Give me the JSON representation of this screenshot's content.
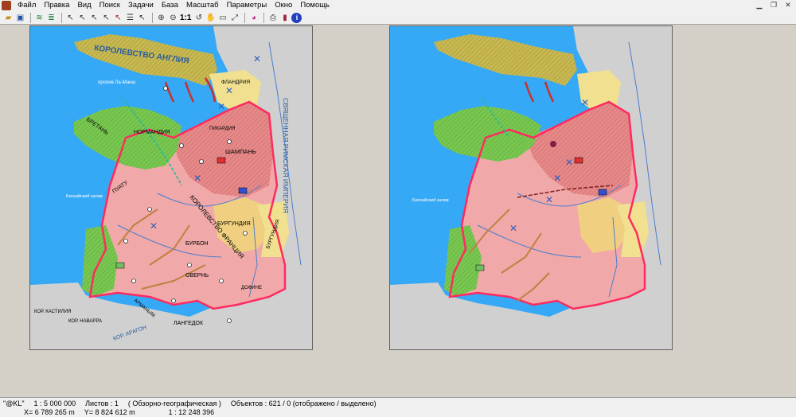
{
  "menu": [
    "Файл",
    "Правка",
    "Вид",
    "Поиск",
    "Задачи",
    "База",
    "Масштаб",
    "Параметры",
    "Окно",
    "Помощь"
  ],
  "toolbar": {
    "zoom_label": "1:1"
  },
  "icons": [
    "open-icon",
    "save-icon",
    "layers-icon",
    "select-icon",
    "zoom-in-icon",
    "zoom-out-icon",
    "hand-icon",
    "print-icon",
    "book-icon",
    "info-icon"
  ],
  "colors": {
    "sea": "#35a9f5",
    "land_gray": "#d0d0d0",
    "france": "#f0a8a8",
    "england": "#c8b850",
    "normandy": "#78c850",
    "burgundy": "#f0e090",
    "border": "#ff2a60"
  },
  "map_left": {
    "labels": {
      "england": "КОРОЛЕВСТВО АНГЛИЯ",
      "channel": "пролив Ла-Манш",
      "flanders": "ФЛАНДРИЯ",
      "normandy": "НОРМАНДИЯ",
      "brittany": "БРЕТАНЬ",
      "champagne": "ШАМПАНЬ",
      "picardy": "ПИКАРДИЯ",
      "hre": "СВЯЩЕННАЯ РИМСКАЯ ИМПЕРИЯ",
      "biscay": "Бискайский залив",
      "poitou": "ПУАТУ",
      "burgundy1": "БУРГУНДИЯ",
      "burgundy2": "БУРГУНДИЯ",
      "bourbon": "БУРБОН",
      "france": "КОРОЛЕВСТВО ФРАНЦИЯ",
      "auvergne": "ОВЕРНЬ",
      "languedoc": "ЛАНГЕДОК",
      "dauphine": "ДОФИНЕ",
      "armagnac": "АРМАНЬЯК",
      "castile": "КОР. КАСТИЛИЯ",
      "navarra": "КОР. НАВАРРА",
      "aragon": "КОР. АРАГОН"
    }
  },
  "map_right": {
    "labels": {
      "biscay": "Бискайский залив"
    }
  },
  "status": {
    "app": "\"@KL\"",
    "scale": "1 : 5 000 000",
    "sheets": "Листов : 1",
    "map_type": "( Обзорно-географическая )",
    "objects": "Объектов : 621 / 0 (отображено / выделено)",
    "x": "X= 6 789 265 m",
    "y": "Y= 8 824 612 m",
    "zoom": "1 : 12 248 396"
  }
}
